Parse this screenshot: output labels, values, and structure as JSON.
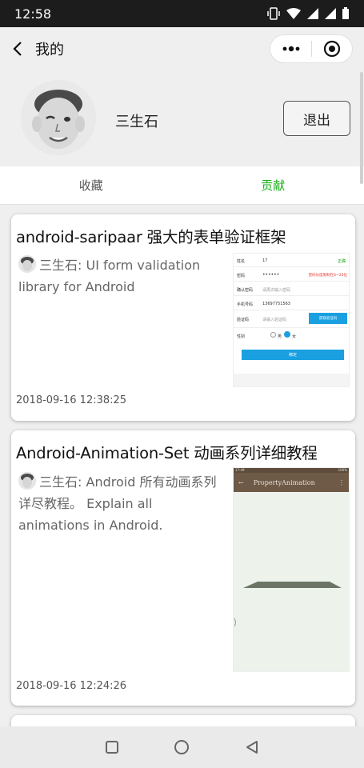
{
  "status_bar": {
    "time": "12:58"
  },
  "nav": {
    "title": "我的"
  },
  "profile": {
    "name": "三生石",
    "logout_label": "退出"
  },
  "tabs": [
    {
      "label": "收藏",
      "active": false
    },
    {
      "label": "贡献",
      "active": true
    }
  ],
  "cards": [
    {
      "title": "android-saripaar 强大的表单验证框架",
      "author": "三生石",
      "description": ": UI form validation library for Android",
      "date": "2018-09-16 12:38:25",
      "thumbnail": {
        "rows": [
          {
            "label": "姓名",
            "value": "17",
            "note": "正确"
          },
          {
            "label": "密码",
            "value": "••••••",
            "note": "密码长度限制在6~20位"
          },
          {
            "label": "确认密码",
            "value": "请再次输入密码",
            "note": ""
          },
          {
            "label": "手机号码",
            "value": "13697751563",
            "note": ""
          },
          {
            "label": "验证码",
            "value": "请输入验证码",
            "note": ""
          },
          {
            "label": "性别",
            "value": "",
            "note": ""
          }
        ],
        "code_button": "获取验证码",
        "gender_male": "男",
        "gender_female": "女",
        "submit_label": "绑定"
      }
    },
    {
      "title": "Android-Animation-Set 动画系列详细教程",
      "author": "三生石",
      "description": ": Android 所有动画系列详尽教程。 Explain all animations in Android.",
      "date": "2018-09-16 12:24:26",
      "thumbnail": {
        "status_time": "17:49",
        "status_right": "100%",
        "toolbar_title": "PropertyAnimation"
      }
    }
  ],
  "colors": {
    "accent_green": "#1aad19",
    "thumb_toolbar": "#6e5a47",
    "thumb_button": "#1aa0e0"
  }
}
